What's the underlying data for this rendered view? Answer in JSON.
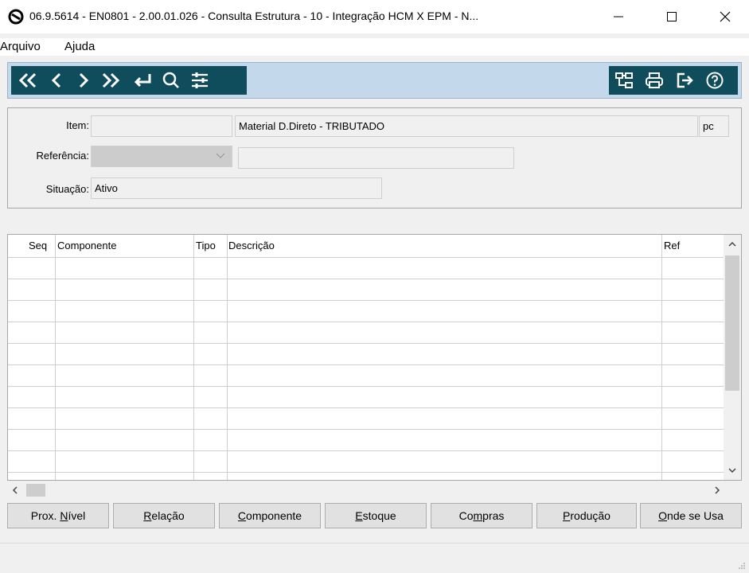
{
  "window": {
    "title": "06.9.5614 - EN0801 - 2.00.01.026 - Consulta Estrutura - 10 - Integração HCM X EPM - N...",
    "minimize_icon": "minimize-icon",
    "maximize_icon": "maximize-icon",
    "close_icon": "close-icon"
  },
  "menu": {
    "items": [
      {
        "label": "Arquivo"
      },
      {
        "label": "Ajuda"
      }
    ]
  },
  "toolbar": {
    "nav_icons": [
      "first-icon",
      "previous-icon",
      "next-icon",
      "last-icon",
      "return-icon",
      "search-icon",
      "filter-settings-icon"
    ],
    "right_icons": [
      "structure-tree-icon",
      "print-icon",
      "exit-icon",
      "help-icon"
    ]
  },
  "form": {
    "item_label": "Item:",
    "item_code": "",
    "item_description": "Material D.Direto - TRIBUTADO",
    "item_unit": "pc",
    "referencia_label": "Referência:",
    "referencia_value": "",
    "referencia_desc": "",
    "situacao_label": "Situação:",
    "situacao_value": "Ativo"
  },
  "grid": {
    "columns": [
      {
        "label": "Seq"
      },
      {
        "label": "Componente"
      },
      {
        "label": "Tipo"
      },
      {
        "label": "Descrição"
      },
      {
        "label": "Ref"
      }
    ],
    "rows": []
  },
  "buttons": [
    {
      "pre": "Prox. ",
      "key": "N",
      "post": "ível"
    },
    {
      "pre": "",
      "key": "R",
      "post": "elação"
    },
    {
      "pre": "",
      "key": "C",
      "post": "omponente"
    },
    {
      "pre": "",
      "key": "E",
      "post": "stoque"
    },
    {
      "pre": "Co",
      "key": "m",
      "post": "pras"
    },
    {
      "pre": "",
      "key": "P",
      "post": "rodução"
    },
    {
      "pre": "",
      "key": "O",
      "post": "nde se Usa"
    }
  ]
}
